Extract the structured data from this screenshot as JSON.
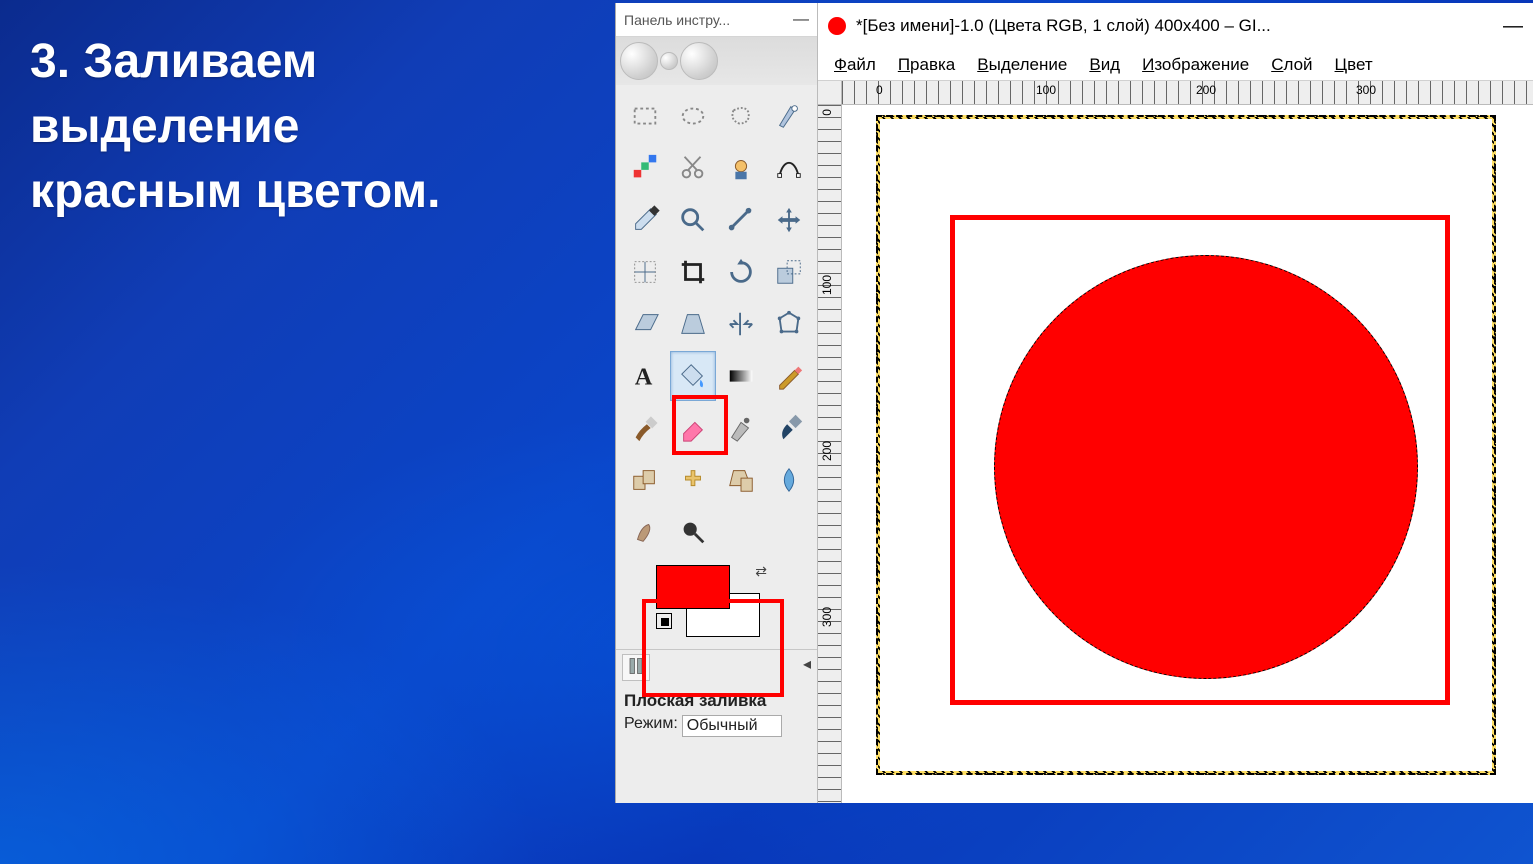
{
  "instruction_text": "3. Заливаем\nвыделение\nкрасным цветом.",
  "toolbox": {
    "title": "Панель инстру...",
    "tools": [
      "rect-select",
      "ellipse-select",
      "free-select",
      "fuzzy-select",
      "color-select",
      "scissors",
      "foreground-select",
      "paths",
      "color-picker",
      "zoom",
      "measure",
      "move",
      "align",
      "crop",
      "rotate",
      "scale",
      "shear",
      "perspective",
      "flip",
      "cage",
      "text",
      "bucket-fill",
      "blend",
      "pencil",
      "paintbrush",
      "eraser",
      "airbrush",
      "ink",
      "clone",
      "heal",
      "perspective-clone",
      "blur",
      "smudge",
      "dodge"
    ],
    "selected_tool_index": 21,
    "fg_color": "#ff0000",
    "bg_color": "#ffffff",
    "options_title": "Плоская заливка",
    "mode_label": "Режим:",
    "mode_value": "Обычный"
  },
  "image_window": {
    "title": "*[Без имени]-1.0 (Цвета RGB, 1 слой) 400x400 – GI...",
    "menu": [
      "Файл",
      "Правка",
      "Выделение",
      "Вид",
      "Изображение",
      "Слой",
      "Цвет"
    ],
    "ruler_h_marks": [
      "0",
      "100",
      "200",
      "300"
    ],
    "ruler_v_marks": [
      "0",
      "100",
      "200",
      "300"
    ]
  }
}
